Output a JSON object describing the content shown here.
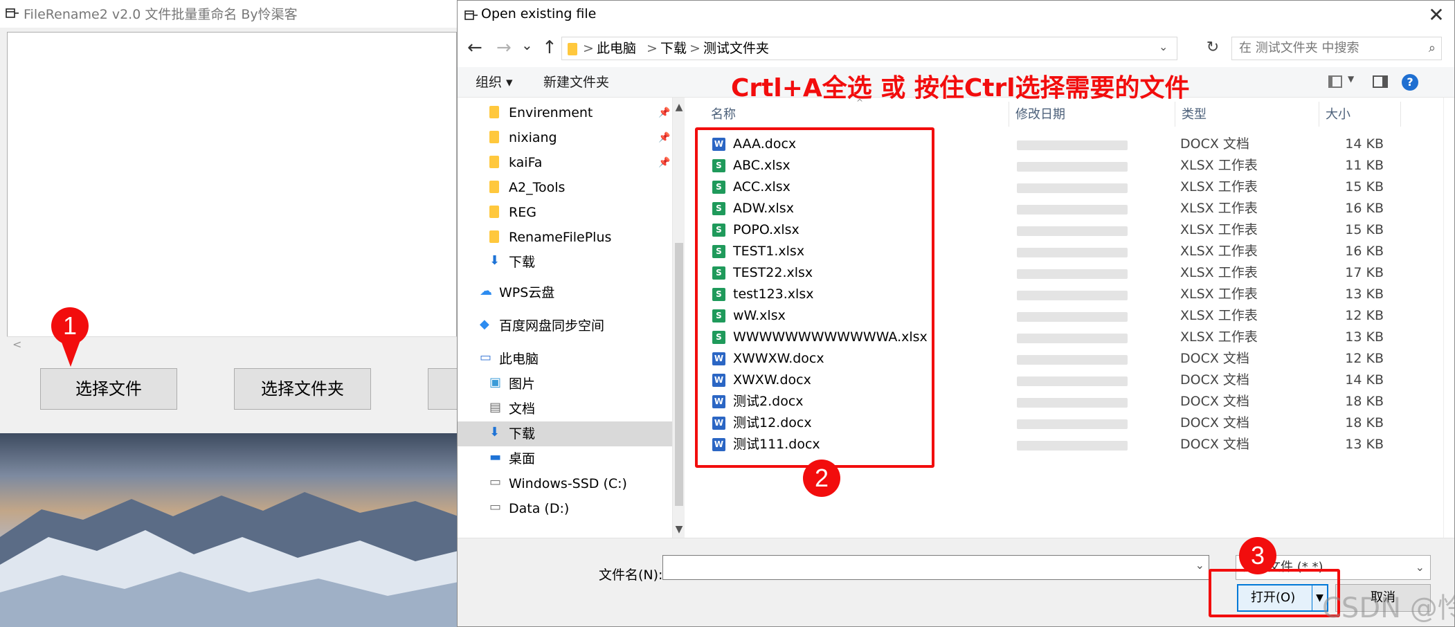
{
  "app": {
    "title": "FileRename2 v2.0   文件批量重命名 By怜渠客",
    "scroll_left_glyph": "<",
    "select_files_button": "选择文件",
    "select_folder_button": "选择文件夹"
  },
  "dialog": {
    "title": "Open existing file",
    "close_glyph": "✕",
    "nav": {
      "back": "←",
      "forward": "→",
      "recent": "⌄",
      "up": "↑",
      "refresh": "↻"
    },
    "address": [
      "此电脑",
      "下载",
      "测试文件夹"
    ],
    "address_sep": ">",
    "search_placeholder": "在 测试文件夹 中搜索",
    "toolbar": {
      "organize": "组织 ▾",
      "new_folder": "新建文件夹",
      "help": "?"
    },
    "columns": {
      "name": "名称",
      "modified": "修改日期",
      "type": "类型",
      "size": "大小"
    },
    "sidebar": [
      {
        "label": "Envirenment",
        "icon": "folder-icon",
        "pinned": true
      },
      {
        "label": "nixiang",
        "icon": "folder-icon",
        "pinned": true
      },
      {
        "label": "kaiFa",
        "icon": "folder-icon",
        "pinned": true
      },
      {
        "label": "A2_Tools",
        "icon": "folder-icon",
        "pinned": false
      },
      {
        "label": "REG",
        "icon": "folder-icon",
        "pinned": false
      },
      {
        "label": "RenameFilePlus",
        "icon": "folder-icon",
        "pinned": false
      },
      {
        "label": "下载",
        "icon": "download-icon",
        "pinned": false
      },
      {
        "label": "WPS云盘",
        "icon": "cloud-icon",
        "pinned": false
      },
      {
        "label": "百度网盘同步空间",
        "icon": "baidu-netdisk-icon",
        "pinned": false
      },
      {
        "label": "此电脑",
        "icon": "computer-icon",
        "pinned": false
      },
      {
        "label": "图片",
        "icon": "pictures-icon",
        "pinned": false
      },
      {
        "label": "文档",
        "icon": "documents-icon",
        "pinned": false
      },
      {
        "label": "下载",
        "icon": "download-icon",
        "pinned": false,
        "selected": true
      },
      {
        "label": "桌面",
        "icon": "desktop-icon",
        "pinned": false
      },
      {
        "label": "Windows-SSD (C:)",
        "icon": "drive-icon",
        "pinned": false
      },
      {
        "label": "Data (D:)",
        "icon": "drive-icon",
        "pinned": false
      }
    ],
    "files": [
      {
        "name": "AAA.docx",
        "kind": "docx",
        "type": "DOCX 文档",
        "size": "14 KB"
      },
      {
        "name": "ABC.xlsx",
        "kind": "xlsx",
        "type": "XLSX 工作表",
        "size": "11 KB"
      },
      {
        "name": "ACC.xlsx",
        "kind": "xlsx",
        "type": "XLSX 工作表",
        "size": "15 KB"
      },
      {
        "name": "ADW.xlsx",
        "kind": "xlsx",
        "type": "XLSX 工作表",
        "size": "16 KB"
      },
      {
        "name": "POPO.xlsx",
        "kind": "xlsx",
        "type": "XLSX 工作表",
        "size": "15 KB"
      },
      {
        "name": "TEST1.xlsx",
        "kind": "xlsx",
        "type": "XLSX 工作表",
        "size": "16 KB"
      },
      {
        "name": "TEST22.xlsx",
        "kind": "xlsx",
        "type": "XLSX 工作表",
        "size": "17 KB"
      },
      {
        "name": "test123.xlsx",
        "kind": "xlsx",
        "type": "XLSX 工作表",
        "size": "13 KB"
      },
      {
        "name": "wW.xlsx",
        "kind": "xlsx",
        "type": "XLSX 工作表",
        "size": "12 KB"
      },
      {
        "name": "WWWWWWWWWWWWA.xlsx",
        "kind": "xlsx",
        "type": "XLSX 工作表",
        "size": "13 KB"
      },
      {
        "name": "XWWXW.docx",
        "kind": "docx",
        "type": "DOCX 文档",
        "size": "12 KB"
      },
      {
        "name": "XWXW.docx",
        "kind": "docx",
        "type": "DOCX 文档",
        "size": "14 KB"
      },
      {
        "name": "测试2.docx",
        "kind": "docx",
        "type": "DOCX 文档",
        "size": "18 KB"
      },
      {
        "name": "测试12.docx",
        "kind": "docx",
        "type": "DOCX 文档",
        "size": "18 KB"
      },
      {
        "name": "测试111.docx",
        "kind": "docx",
        "type": "DOCX 文档",
        "size": "13 KB"
      }
    ],
    "filename_label": "文件名(N):",
    "filename_value": "",
    "filetype_value": "所有文件 (*.*)",
    "open_button": "打开(O)",
    "cancel_button": "取消"
  },
  "annotations": {
    "hint": "Crtl+A全选 或 按住Ctrl选择需要的文件",
    "badges": [
      "1",
      "2",
      "3"
    ],
    "watermark": "CSDN @怜渠客"
  },
  "colors": {
    "annotation_red": "#f20d0d",
    "accent_blue": "#0078d7",
    "word_blue": "#2b66c4",
    "excel_green": "#1f9a5b",
    "folder_yellow": "#ffc83d"
  }
}
